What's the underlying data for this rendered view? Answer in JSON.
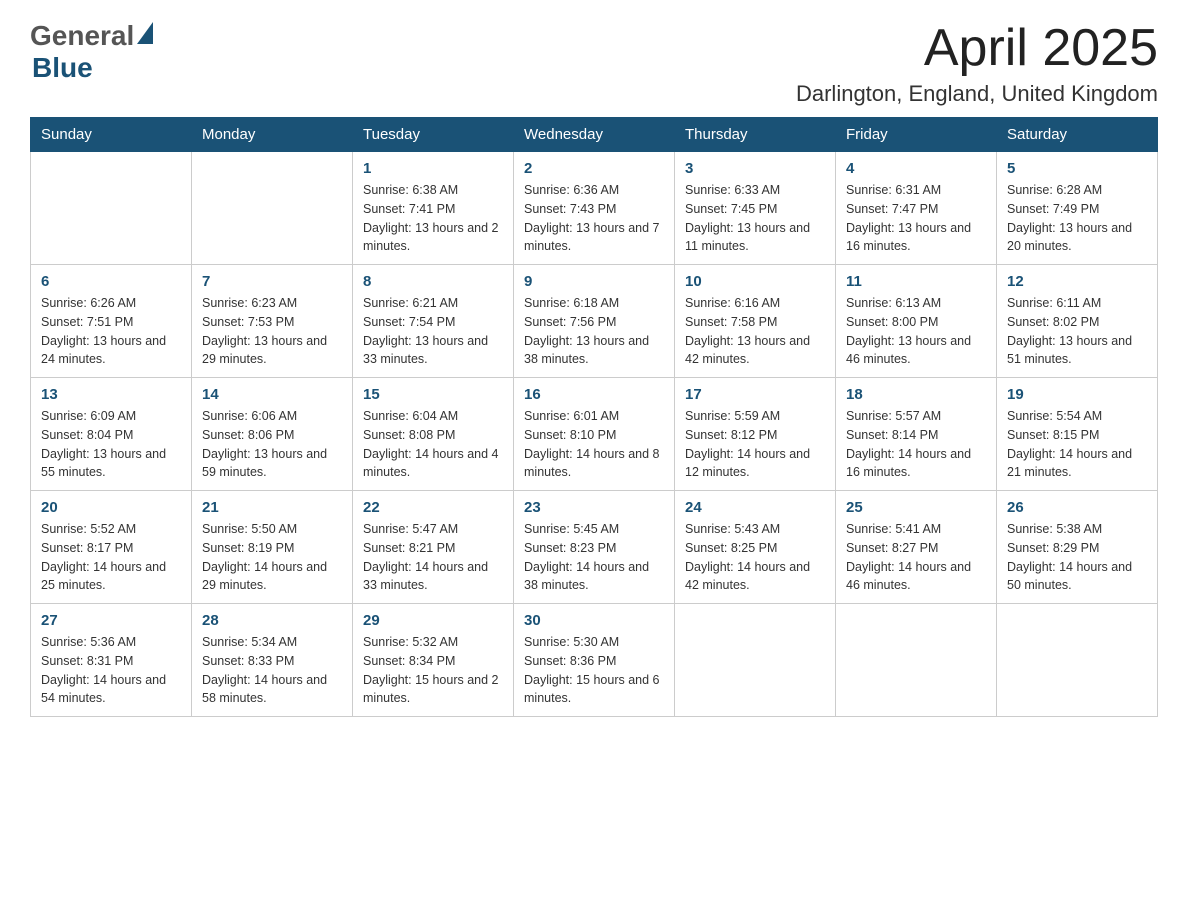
{
  "logo": {
    "text_general": "General",
    "text_blue": "Blue"
  },
  "title": {
    "month_year": "April 2025",
    "location": "Darlington, England, United Kingdom"
  },
  "days_of_week": [
    "Sunday",
    "Monday",
    "Tuesday",
    "Wednesday",
    "Thursday",
    "Friday",
    "Saturday"
  ],
  "weeks": [
    [
      {
        "day": "",
        "sunrise": "",
        "sunset": "",
        "daylight": ""
      },
      {
        "day": "",
        "sunrise": "",
        "sunset": "",
        "daylight": ""
      },
      {
        "day": "1",
        "sunrise": "Sunrise: 6:38 AM",
        "sunset": "Sunset: 7:41 PM",
        "daylight": "Daylight: 13 hours and 2 minutes."
      },
      {
        "day": "2",
        "sunrise": "Sunrise: 6:36 AM",
        "sunset": "Sunset: 7:43 PM",
        "daylight": "Daylight: 13 hours and 7 minutes."
      },
      {
        "day": "3",
        "sunrise": "Sunrise: 6:33 AM",
        "sunset": "Sunset: 7:45 PM",
        "daylight": "Daylight: 13 hours and 11 minutes."
      },
      {
        "day": "4",
        "sunrise": "Sunrise: 6:31 AM",
        "sunset": "Sunset: 7:47 PM",
        "daylight": "Daylight: 13 hours and 16 minutes."
      },
      {
        "day": "5",
        "sunrise": "Sunrise: 6:28 AM",
        "sunset": "Sunset: 7:49 PM",
        "daylight": "Daylight: 13 hours and 20 minutes."
      }
    ],
    [
      {
        "day": "6",
        "sunrise": "Sunrise: 6:26 AM",
        "sunset": "Sunset: 7:51 PM",
        "daylight": "Daylight: 13 hours and 24 minutes."
      },
      {
        "day": "7",
        "sunrise": "Sunrise: 6:23 AM",
        "sunset": "Sunset: 7:53 PM",
        "daylight": "Daylight: 13 hours and 29 minutes."
      },
      {
        "day": "8",
        "sunrise": "Sunrise: 6:21 AM",
        "sunset": "Sunset: 7:54 PM",
        "daylight": "Daylight: 13 hours and 33 minutes."
      },
      {
        "day": "9",
        "sunrise": "Sunrise: 6:18 AM",
        "sunset": "Sunset: 7:56 PM",
        "daylight": "Daylight: 13 hours and 38 minutes."
      },
      {
        "day": "10",
        "sunrise": "Sunrise: 6:16 AM",
        "sunset": "Sunset: 7:58 PM",
        "daylight": "Daylight: 13 hours and 42 minutes."
      },
      {
        "day": "11",
        "sunrise": "Sunrise: 6:13 AM",
        "sunset": "Sunset: 8:00 PM",
        "daylight": "Daylight: 13 hours and 46 minutes."
      },
      {
        "day": "12",
        "sunrise": "Sunrise: 6:11 AM",
        "sunset": "Sunset: 8:02 PM",
        "daylight": "Daylight: 13 hours and 51 minutes."
      }
    ],
    [
      {
        "day": "13",
        "sunrise": "Sunrise: 6:09 AM",
        "sunset": "Sunset: 8:04 PM",
        "daylight": "Daylight: 13 hours and 55 minutes."
      },
      {
        "day": "14",
        "sunrise": "Sunrise: 6:06 AM",
        "sunset": "Sunset: 8:06 PM",
        "daylight": "Daylight: 13 hours and 59 minutes."
      },
      {
        "day": "15",
        "sunrise": "Sunrise: 6:04 AM",
        "sunset": "Sunset: 8:08 PM",
        "daylight": "Daylight: 14 hours and 4 minutes."
      },
      {
        "day": "16",
        "sunrise": "Sunrise: 6:01 AM",
        "sunset": "Sunset: 8:10 PM",
        "daylight": "Daylight: 14 hours and 8 minutes."
      },
      {
        "day": "17",
        "sunrise": "Sunrise: 5:59 AM",
        "sunset": "Sunset: 8:12 PM",
        "daylight": "Daylight: 14 hours and 12 minutes."
      },
      {
        "day": "18",
        "sunrise": "Sunrise: 5:57 AM",
        "sunset": "Sunset: 8:14 PM",
        "daylight": "Daylight: 14 hours and 16 minutes."
      },
      {
        "day": "19",
        "sunrise": "Sunrise: 5:54 AM",
        "sunset": "Sunset: 8:15 PM",
        "daylight": "Daylight: 14 hours and 21 minutes."
      }
    ],
    [
      {
        "day": "20",
        "sunrise": "Sunrise: 5:52 AM",
        "sunset": "Sunset: 8:17 PM",
        "daylight": "Daylight: 14 hours and 25 minutes."
      },
      {
        "day": "21",
        "sunrise": "Sunrise: 5:50 AM",
        "sunset": "Sunset: 8:19 PM",
        "daylight": "Daylight: 14 hours and 29 minutes."
      },
      {
        "day": "22",
        "sunrise": "Sunrise: 5:47 AM",
        "sunset": "Sunset: 8:21 PM",
        "daylight": "Daylight: 14 hours and 33 minutes."
      },
      {
        "day": "23",
        "sunrise": "Sunrise: 5:45 AM",
        "sunset": "Sunset: 8:23 PM",
        "daylight": "Daylight: 14 hours and 38 minutes."
      },
      {
        "day": "24",
        "sunrise": "Sunrise: 5:43 AM",
        "sunset": "Sunset: 8:25 PM",
        "daylight": "Daylight: 14 hours and 42 minutes."
      },
      {
        "day": "25",
        "sunrise": "Sunrise: 5:41 AM",
        "sunset": "Sunset: 8:27 PM",
        "daylight": "Daylight: 14 hours and 46 minutes."
      },
      {
        "day": "26",
        "sunrise": "Sunrise: 5:38 AM",
        "sunset": "Sunset: 8:29 PM",
        "daylight": "Daylight: 14 hours and 50 minutes."
      }
    ],
    [
      {
        "day": "27",
        "sunrise": "Sunrise: 5:36 AM",
        "sunset": "Sunset: 8:31 PM",
        "daylight": "Daylight: 14 hours and 54 minutes."
      },
      {
        "day": "28",
        "sunrise": "Sunrise: 5:34 AM",
        "sunset": "Sunset: 8:33 PM",
        "daylight": "Daylight: 14 hours and 58 minutes."
      },
      {
        "day": "29",
        "sunrise": "Sunrise: 5:32 AM",
        "sunset": "Sunset: 8:34 PM",
        "daylight": "Daylight: 15 hours and 2 minutes."
      },
      {
        "day": "30",
        "sunrise": "Sunrise: 5:30 AM",
        "sunset": "Sunset: 8:36 PM",
        "daylight": "Daylight: 15 hours and 6 minutes."
      },
      {
        "day": "",
        "sunrise": "",
        "sunset": "",
        "daylight": ""
      },
      {
        "day": "",
        "sunrise": "",
        "sunset": "",
        "daylight": ""
      },
      {
        "day": "",
        "sunrise": "",
        "sunset": "",
        "daylight": ""
      }
    ]
  ]
}
